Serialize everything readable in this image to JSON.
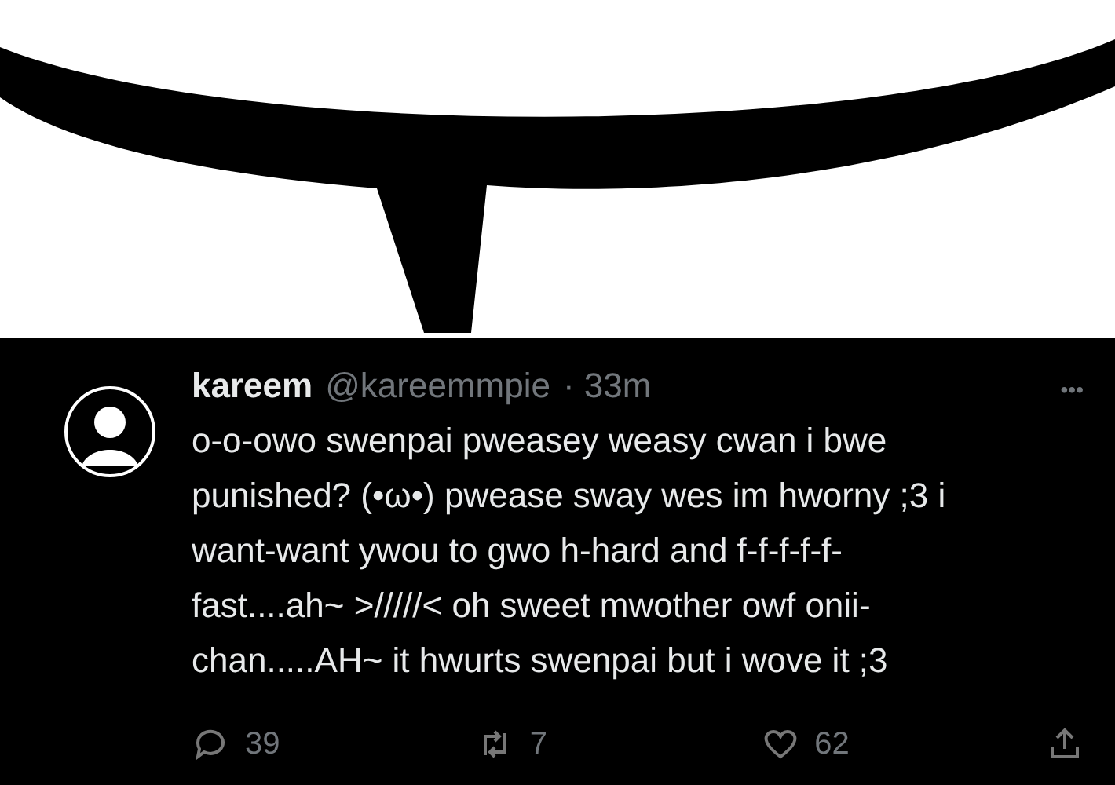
{
  "post": {
    "display_name": "kareem",
    "handle": "@kareemmpie",
    "time": "· 33m",
    "more": "•••",
    "text": "o-o-owo swenpai pweasey weasy cwan i bwe\npunished? (•ω•) pwease sway wes im hworny ;3 i\nwant-want ywou to gwo h-hard and f-f-f-f-f-\nfast....ah~ >/////< oh sweet mwother owf onii-\nchan.....AH~ it hwurts swenpai  but i wove it ;3",
    "actions": [
      {
        "kind": "reply",
        "count": "39"
      },
      {
        "kind": "repost",
        "count": "7"
      },
      {
        "kind": "like",
        "count": "62"
      },
      {
        "kind": "share"
      }
    ]
  }
}
